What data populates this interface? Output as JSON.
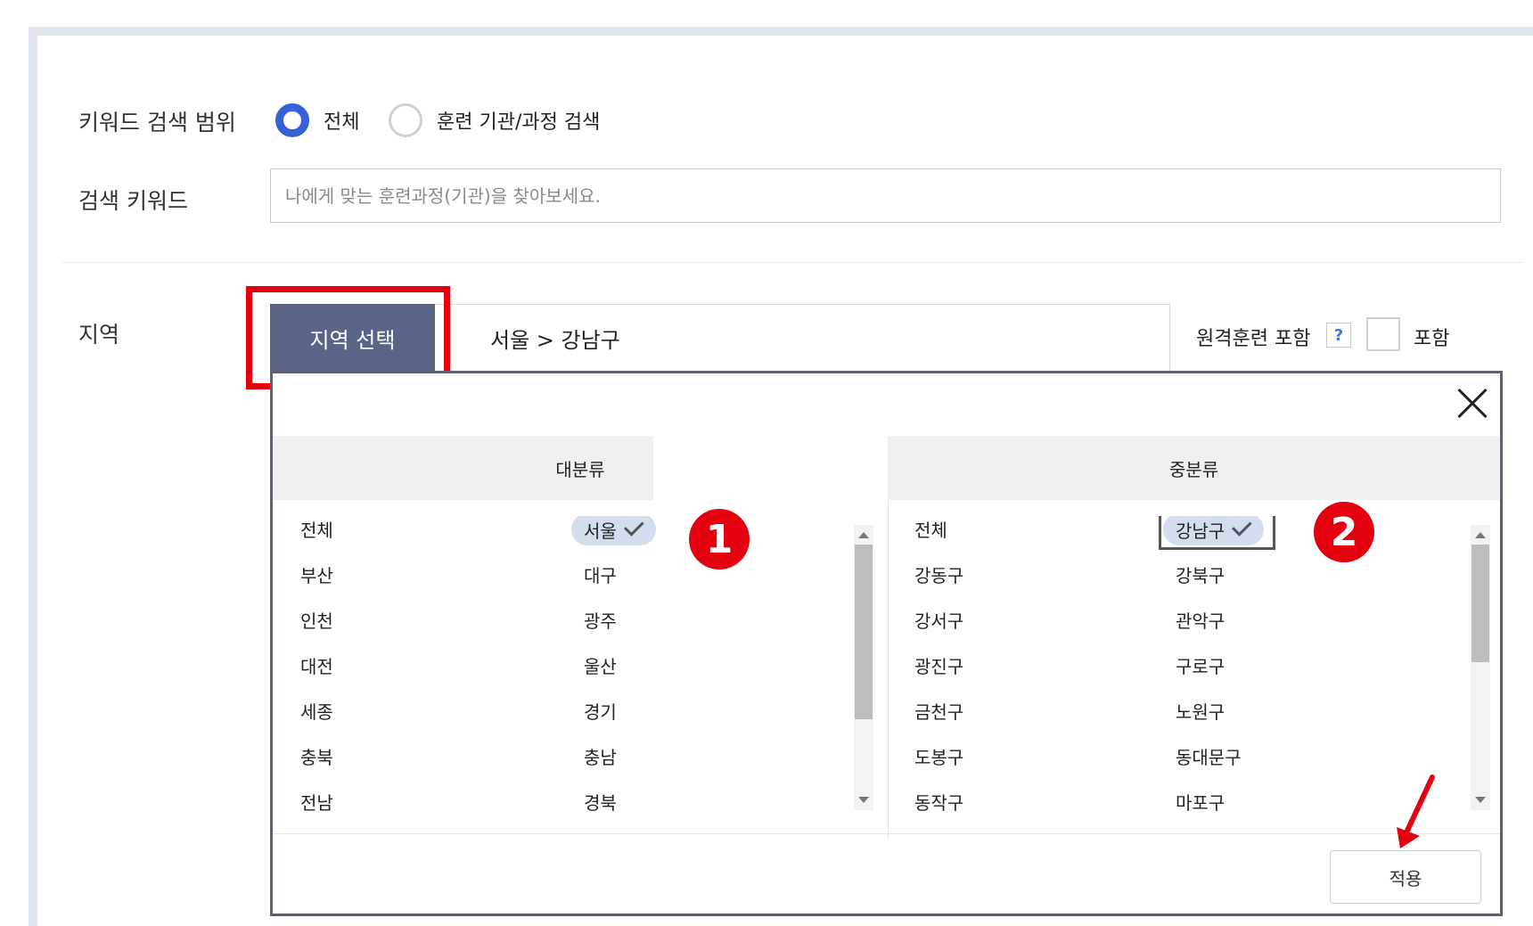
{
  "search_scope": {
    "label": "키워드 검색 범위",
    "options": [
      {
        "label": "전체",
        "checked": true
      },
      {
        "label": "훈련 기관/과정 검색",
        "checked": false
      }
    ]
  },
  "keyword": {
    "label": "검색 키워드",
    "placeholder": "나에게 맞는 훈련과정(기관)을 찾아보세요.",
    "value": ""
  },
  "region": {
    "label": "지역",
    "select_button": "지역 선택",
    "selected_path": "서울 > 강남구",
    "remote_label": "원격훈련 포함",
    "help_label": "?",
    "include_label": "포함",
    "include_checked": false
  },
  "popup": {
    "major_header": "대분류",
    "middle_header": "중분류",
    "major_items": [
      "전체",
      "서울",
      "부산",
      "대구",
      "인천",
      "광주",
      "대전",
      "울산",
      "세종",
      "경기",
      "충북",
      "충남",
      "전남",
      "경북"
    ],
    "major_selected": "서울",
    "middle_items": [
      "전체",
      "강남구",
      "강동구",
      "강북구",
      "강서구",
      "관악구",
      "광진구",
      "구로구",
      "금천구",
      "노원구",
      "도봉구",
      "동대문구",
      "동작구",
      "마포구"
    ],
    "middle_selected": "강남구",
    "apply_label": "적용"
  },
  "annotations": {
    "step1": "1",
    "step2": "2"
  },
  "colors": {
    "accent_blue": "#3563d6",
    "region_button_bg": "#5a6487",
    "annotation_red": "#e3000f",
    "chip_bg": "#d4ddee"
  }
}
